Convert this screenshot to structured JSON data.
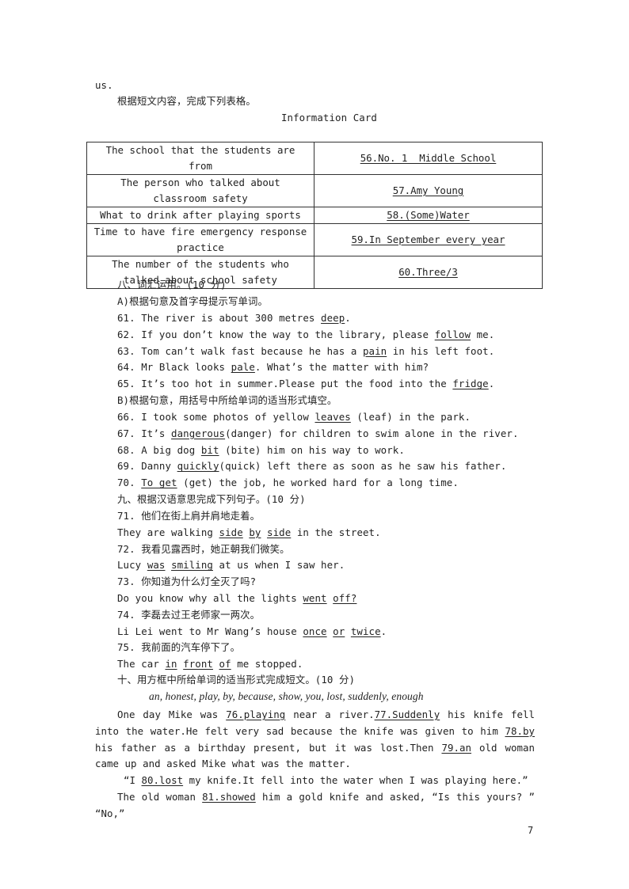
{
  "intro": {
    "tail": "us.",
    "instruction": "根据短文内容，完成下列表格。",
    "card_title": "Information Card"
  },
  "card": {
    "rows": [
      {
        "question": "The school that the students are from",
        "answer": "56.No._1__Middle_School"
      },
      {
        "question": "The person who talked about classroom safety",
        "answer": "57.Amy_Young"
      },
      {
        "question": "What to drink after playing sports",
        "answer": "58.(Some)Water"
      },
      {
        "question": "Time to have fire emergency response practice",
        "answer": "59.In September every year"
      },
      {
        "question": "The number of the students who talked about school safety",
        "answer": "60.Three/3"
      }
    ]
  },
  "section8": {
    "heading": "八、词汇运用。(10 分)",
    "partA": {
      "instruction": "A)根据句意及首字母提示写单词。",
      "items": [
        {
          "before": "61. The river is about 300 metres ",
          "answer": "deep",
          "after": "."
        },
        {
          "before": "62. If you don’t know the way to the library, please ",
          "answer": "follow",
          "after": " me."
        },
        {
          "before": "63. Tom can’t walk fast because he has a ",
          "answer": "pain",
          "after": " in his left foot."
        },
        {
          "before": "64. Mr Black looks ",
          "answer": "pale",
          "after": ". What’s the matter with him?"
        },
        {
          "before": "65. It’s too hot in summer.Please put the food into the ",
          "answer": "fridge",
          "after": "."
        }
      ]
    },
    "partB": {
      "instruction": "B)根据句意，用括号中所给单词的适当形式填空。",
      "items": [
        {
          "before": "66. I took some photos of yellow ",
          "answer": "leaves",
          "after": " (leaf) in the park."
        },
        {
          "before": "67. It’s ",
          "answer": "dangerous",
          "after": "(danger) for children to swim alone in the river."
        },
        {
          "before": "68. A big dog ",
          "answer": "bit",
          "after": " (bite) him on his way to work."
        },
        {
          "before": "69. Danny ",
          "answer": "quickly",
          "after": "(quick) left there as soon as he saw his father."
        },
        {
          "before": "70. ",
          "answer": "To get",
          "after": " (get) the job, he worked hard for a long time."
        }
      ]
    }
  },
  "section9": {
    "heading": "九、根据汉语意思完成下列句子。(10 分)",
    "items": [
      {
        "chinese": "71. 他们在街上肩并肩地走着。",
        "en": [
          {
            "t": "They are walking "
          },
          {
            "t": "side",
            "u": true
          },
          {
            "t": " "
          },
          {
            "t": "by",
            "u": true
          },
          {
            "t": " "
          },
          {
            "t": "side",
            "u": true
          },
          {
            "t": " in the street."
          }
        ]
      },
      {
        "chinese": "72. 我看见露西时，她正朝我们微笑。",
        "en": [
          {
            "t": "Lucy "
          },
          {
            "t": "was",
            "u": true
          },
          {
            "t": " "
          },
          {
            "t": "smiling",
            "u": true
          },
          {
            "t": " at us when I saw her."
          }
        ]
      },
      {
        "chinese": "73. 你知道为什么灯全灭了吗?",
        "en": [
          {
            "t": "Do you know why all the lights "
          },
          {
            "t": "went",
            "u": true
          },
          {
            "t": " "
          },
          {
            "t": "off?",
            "u": true
          }
        ]
      },
      {
        "chinese": "74. 李磊去过王老师家一两次。",
        "en": [
          {
            "t": "Li Lei went to Mr Wang’s house "
          },
          {
            "t": "once",
            "u": true
          },
          {
            "t": " "
          },
          {
            "t": "or",
            "u": true
          },
          {
            "t": " "
          },
          {
            "t": "twice",
            "u": true
          },
          {
            "t": "."
          }
        ]
      },
      {
        "chinese": "75. 我前面的汽车停下了。",
        "en": [
          {
            "t": "The car "
          },
          {
            "t": "in",
            "u": true
          },
          {
            "t": " "
          },
          {
            "t": "front",
            "u": true
          },
          {
            "t": " "
          },
          {
            "t": "of",
            "u": true
          },
          {
            "t": " me stopped."
          }
        ]
      }
    ]
  },
  "section10": {
    "heading": "十、用方框中所给单词的适当形式完成短文。(10 分)",
    "word_box": "an, honest, play, by, because, show, you, lost, suddenly, enough",
    "passage": [
      [
        {
          "t": "One day Mike was "
        },
        {
          "t": "76.playing",
          "u": true
        },
        {
          "t": " near a river."
        },
        {
          "t": "77.Suddenly",
          "u": true
        },
        {
          "t": " his knife fell into the water.He felt very sad because the knife was given to him "
        },
        {
          "t": "78.by",
          "u": true
        },
        {
          "t": " his father as a birthday present, but it was lost.Then "
        },
        {
          "t": "79.an",
          "u": true
        },
        {
          "t": " old woman came up and asked Mike what was the matter."
        }
      ],
      [
        {
          "t": "“I "
        },
        {
          "t": "80.lost",
          "u": true
        },
        {
          "t": " my knife.It fell into the water when I was playing here.”"
        }
      ],
      [
        {
          "t": "The old woman "
        },
        {
          "t": "81.showed",
          "u": true
        },
        {
          "t": " him a gold knife and asked, “Is this yours? ” “No,”"
        }
      ]
    ]
  },
  "page_number": "7"
}
